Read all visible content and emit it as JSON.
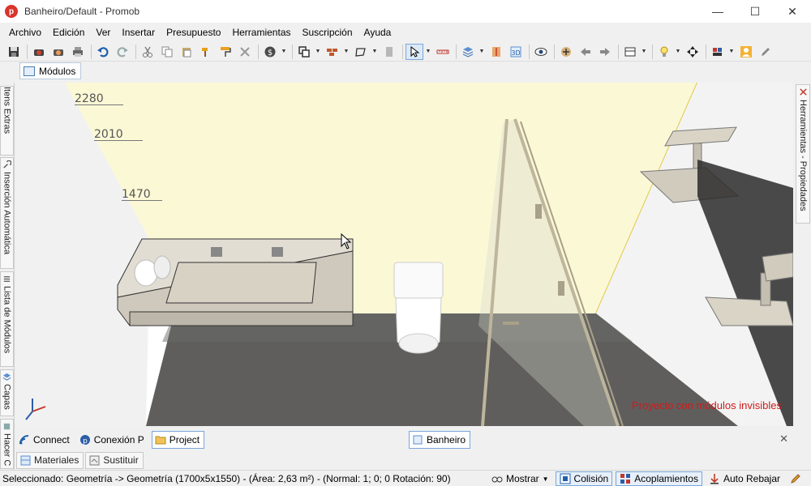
{
  "window": {
    "title": "Banheiro/Default - Promob",
    "minimize_glyph": "—",
    "maximize_glyph": "☐",
    "close_glyph": "✕"
  },
  "menu": [
    "Archivo",
    "Edición",
    "Ver",
    "Insertar",
    "Presupuesto",
    "Herramientas",
    "Suscripción",
    "Ayuda"
  ],
  "toolbar": {
    "icons": [
      "save-icon",
      "render-icon",
      "render-settings-icon",
      "print-icon",
      "undo-icon",
      "redo-icon",
      "cut-icon",
      "copy-icon",
      "paste-icon",
      "paint-icon",
      "paint-roller-icon",
      "delete-icon",
      "budget-icon",
      "copy-module-icon",
      "wall-icon",
      "shape-icon",
      "door-icon",
      "select-icon",
      "measure-icon",
      "layers-icon",
      "dimension-icon",
      "3d-icon",
      "eye-icon",
      "view-move-icon",
      "view-left-icon",
      "view-right-icon",
      "view-mode-icon",
      "light-icon",
      "snap-icon",
      "color-icon",
      "user-icon",
      "edit-icon"
    ],
    "label_3d": "3D"
  },
  "doc_tab": {
    "label": "Módulos"
  },
  "left_panel": {
    "tabs": [
      "Itens Extras",
      "Inserción Automática",
      "Lista de Módulos",
      "Capas",
      "Hacer C"
    ]
  },
  "right_panel": {
    "tab": "Herramientas - Propiedades"
  },
  "viewport": {
    "dimensions": [
      "2280",
      "2010",
      "1470"
    ],
    "invisible_modules_msg": "Proyecto con módulos invisibles",
    "colors": {
      "back_wall": "#fbf8d6",
      "left_wall": "#f2f2f2",
      "floor": "#5f5e5c",
      "counter": "#d9d4c9",
      "invisible_msg": "#d01b1b"
    }
  },
  "bottom_panel": {
    "tabs": [
      "Connect",
      "Conexión P",
      "Project"
    ],
    "scene_tab": "Banheiro",
    "close": "✕"
  },
  "material_tabs": [
    "Materiales",
    "Sustituir"
  ],
  "status": {
    "selection": "Seleccionado: Geometría -> Geometría (1700x5x1550) - (Área: 2,63 m²) - (Normal: 1; 0; 0 Rotación: 90)",
    "mostrar": "Mostrar",
    "colision": "Colisión",
    "acoplamientos": "Acoplamientos",
    "auto_rebajar": "Auto Rebajar"
  }
}
